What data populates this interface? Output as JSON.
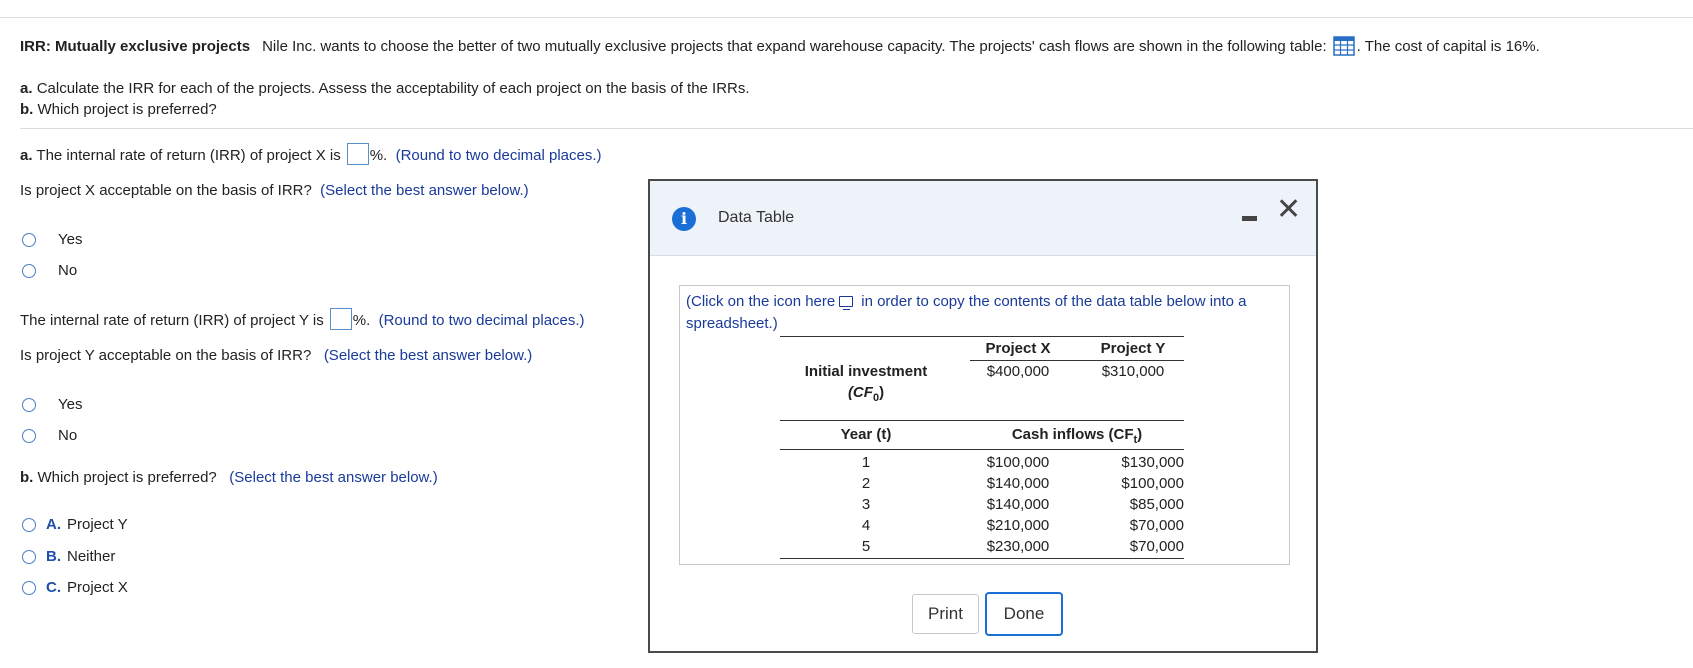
{
  "header": {
    "title": "IRR: Mutually exclusive projects",
    "text": "Nile Inc. wants to choose the better of two mutually exclusive projects that  expand warehouse capacity.  The projects' cash flows are shown in the following table:",
    "cost_text": ". The cost of capital is 16%."
  },
  "instructions": {
    "a_letter": "a.",
    "a_text": "Calculate the IRR for each of the projects.  Assess the acceptability of each project on the basis of the IRRs.",
    "b_letter": "b.",
    "b_text": "Which project is preferred?"
  },
  "part_a": {
    "letter": "a.",
    "irr_x_text": "The internal rate of return (IRR) of project X is",
    "irr_x_value": "",
    "round_note": "(Round to two decimal places.)",
    "pct": "%.",
    "accept_x_question": "Is project X acceptable on the basis of IRR?",
    "select_note": "(Select the best answer below.)",
    "options_x": [
      "Yes",
      "No"
    ],
    "irr_y_text": "The internal rate of return (IRR) of project Y is",
    "irr_y_value": "",
    "accept_y_question": "Is project Y acceptable on the basis of IRR?",
    "options_y": [
      "Yes",
      "No"
    ]
  },
  "part_b": {
    "letter": "b.",
    "question": "Which project is preferred?",
    "select_note": "(Select the best answer below.)",
    "options": [
      {
        "letter": "A.",
        "label": "Project Y"
      },
      {
        "letter": "B.",
        "label": "Neither"
      },
      {
        "letter": "C.",
        "label": "Project X"
      }
    ]
  },
  "modal": {
    "title": "Data Table",
    "copy_text_1": "(Click on the icon here",
    "copy_text_2": "in order to copy the contents of the data table below into a spreadsheet.)",
    "table": {
      "col_headers": [
        "Project X",
        "Project Y"
      ],
      "initial_label_1": "Initial investment",
      "initial_label_2": "(CF",
      "initial_label_sub": "0",
      "initial_label_3": ")",
      "initial_values": [
        "$400,000",
        "$310,000"
      ],
      "year_label": "Year (t)",
      "cash_label": "Cash inflows (CF",
      "cash_sub": "t",
      "cash_close": ")",
      "rows": [
        {
          "year": "1",
          "x": "$100,000",
          "y": "$130,000"
        },
        {
          "year": "2",
          "x": "$140,000",
          "y": "$100,000"
        },
        {
          "year": "3",
          "x": "$140,000",
          "y": "$85,000"
        },
        {
          "year": "4",
          "x": "$210,000",
          "y": "$70,000"
        },
        {
          "year": "5",
          "x": "$230,000",
          "y": "$70,000"
        }
      ]
    },
    "print_label": "Print",
    "done_label": "Done"
  },
  "colors": {
    "accent": "#1a6fd6",
    "link_blue": "#1a3a9a",
    "radio": "#4a7fc6"
  }
}
